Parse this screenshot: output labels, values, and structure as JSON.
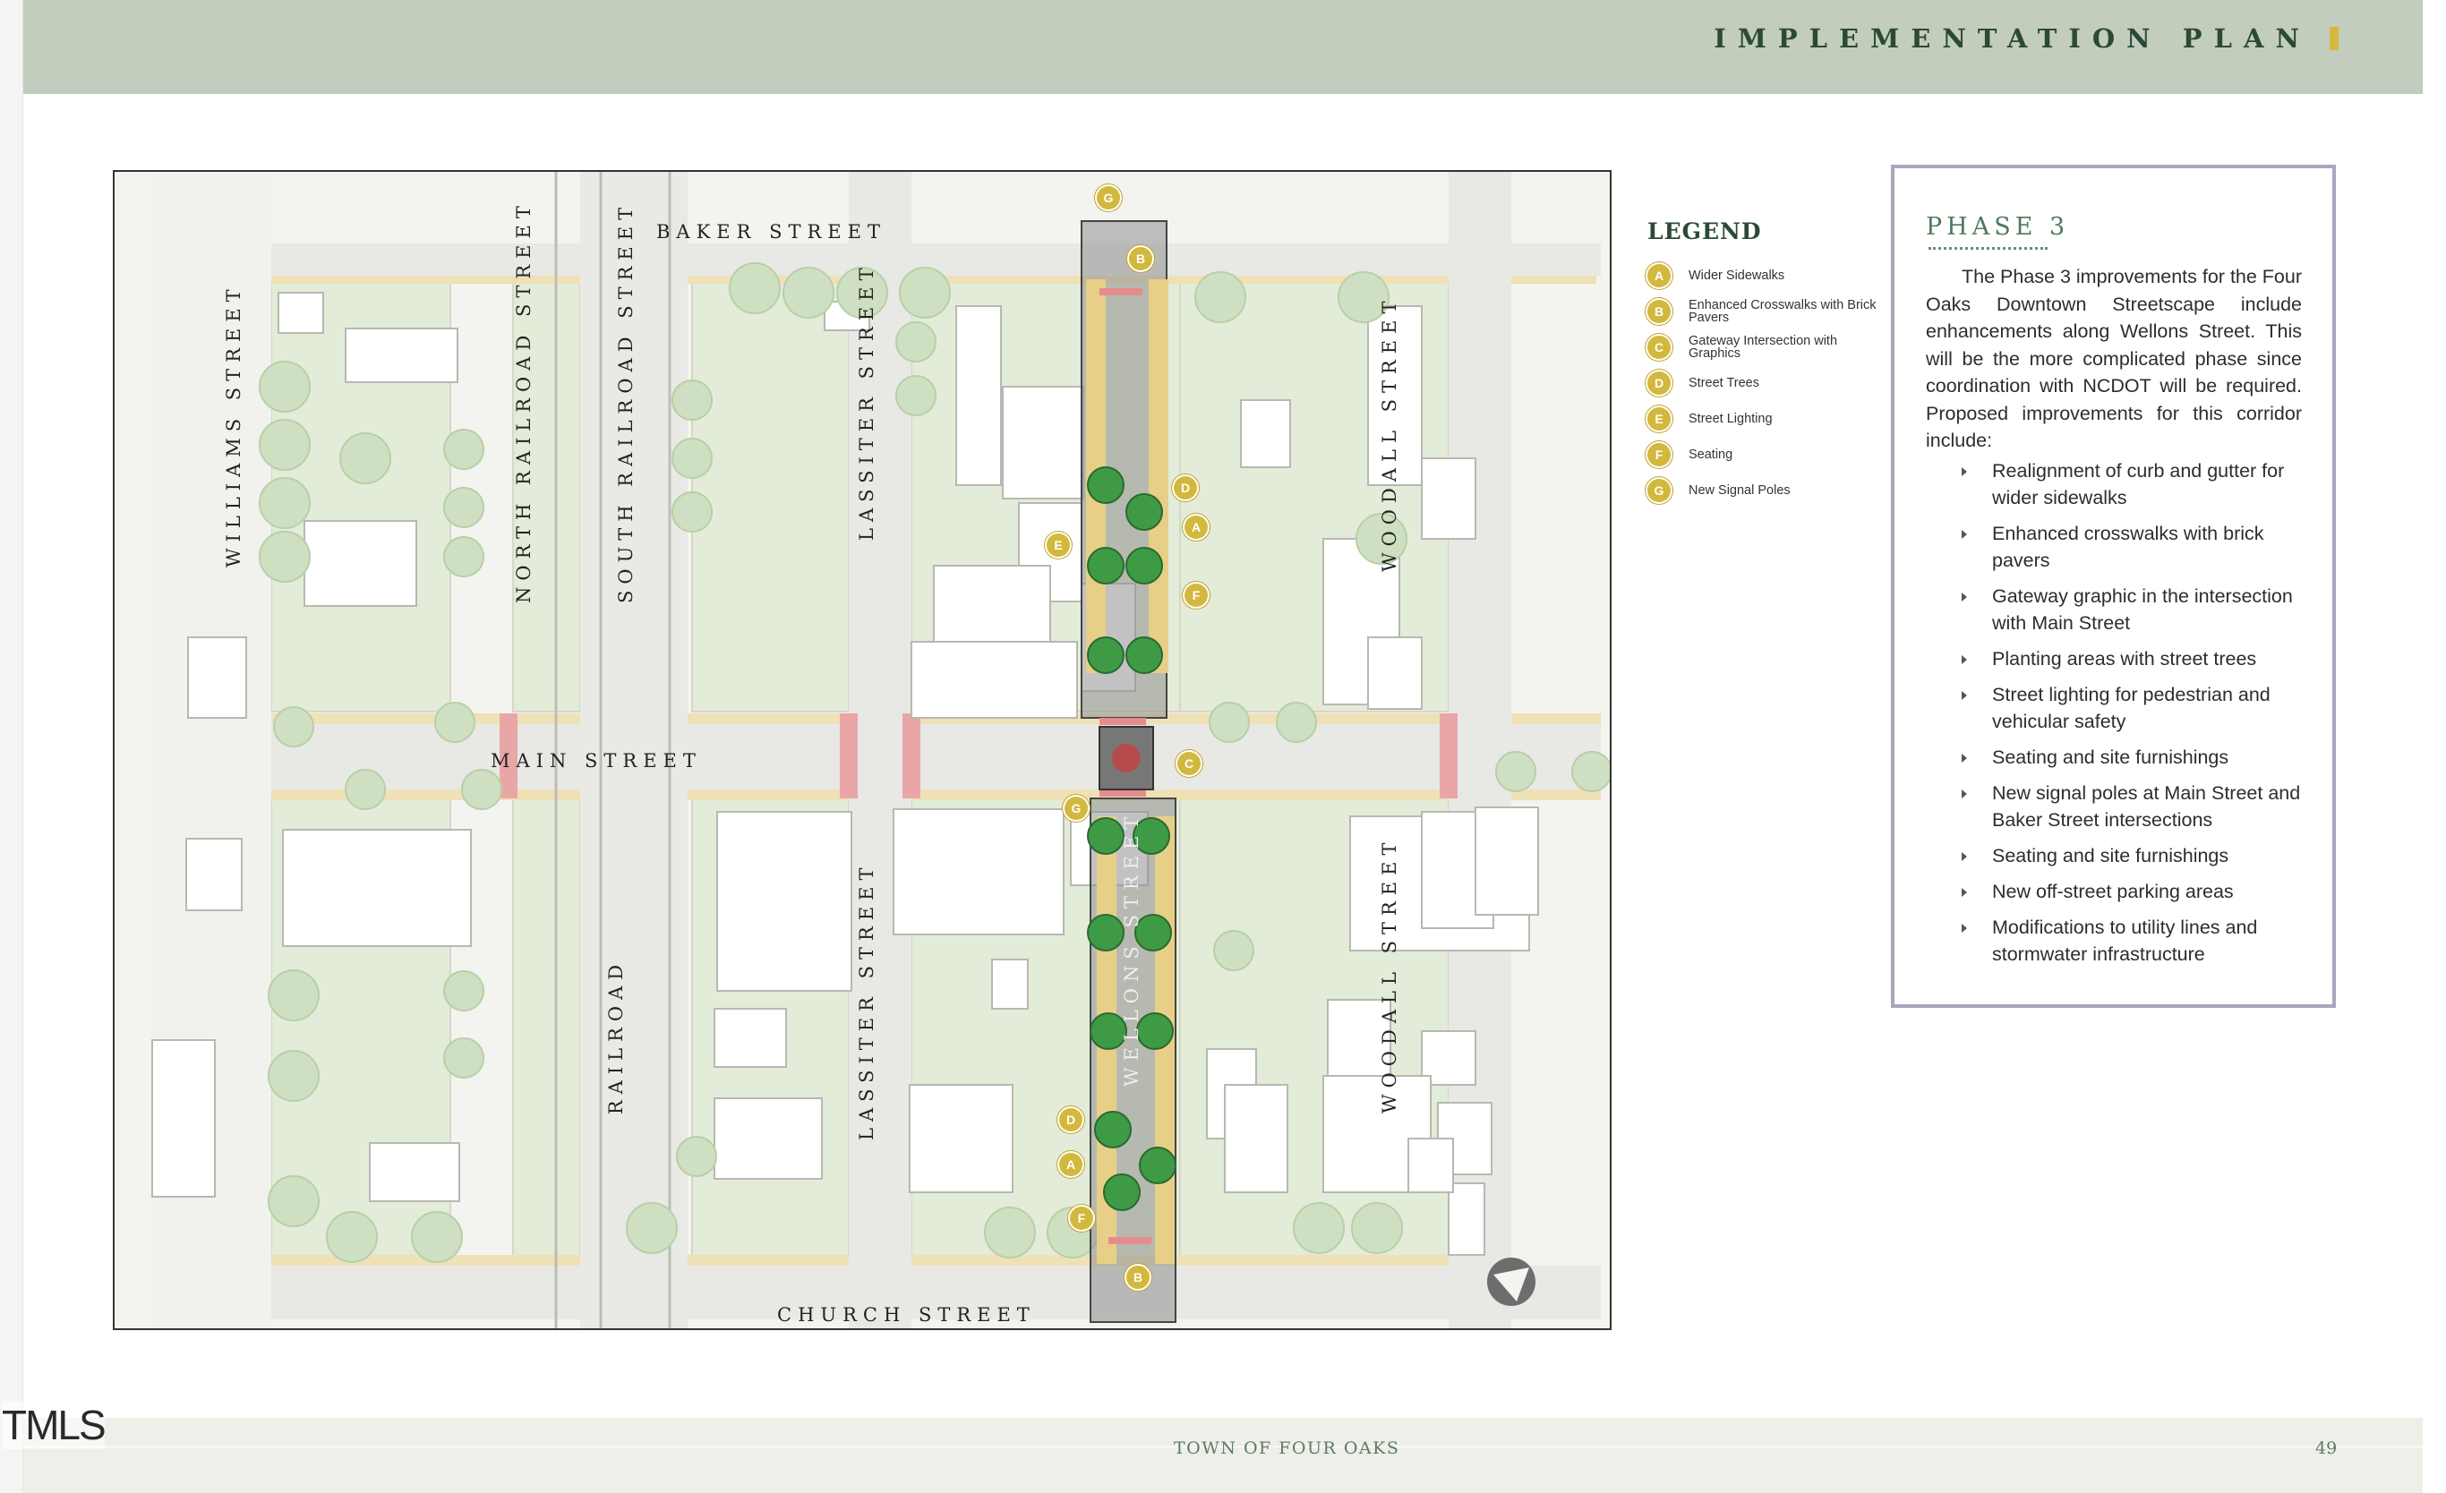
{
  "header": {
    "title": "IMPLEMENTATION PLAN"
  },
  "plan": {
    "streets": {
      "baker": "BAKER STREET",
      "main": "MAIN STREET",
      "church": "CHURCH STREET",
      "williams": "WILLIAMS STREET",
      "north_railroad": "NORTH RAILROAD STREET",
      "south_railroad": "SOUTH RAILROAD STREET",
      "railroad": "RAILROAD",
      "lassiter_top": "LASSITER STREET",
      "lassiter_bottom": "LASSITER STREET",
      "woodall_top": "WOODALL STREET",
      "woodall_bottom": "WOODALL STREET",
      "wellons": "WELLONS STREET"
    },
    "markers": [
      "G",
      "B",
      "D",
      "A",
      "E",
      "F",
      "C",
      "G",
      "D",
      "A",
      "F",
      "B"
    ]
  },
  "legend": {
    "title": "LEGEND",
    "items": [
      {
        "badge": "A",
        "label": "Wider Sidewalks"
      },
      {
        "badge": "B",
        "label": "Enhanced Crosswalks with Brick Pavers"
      },
      {
        "badge": "C",
        "label": "Gateway Intersection with Graphics"
      },
      {
        "badge": "D",
        "label": "Street Trees"
      },
      {
        "badge": "E",
        "label": "Street Lighting"
      },
      {
        "badge": "F",
        "label": "Seating"
      },
      {
        "badge": "G",
        "label": "New Signal Poles"
      }
    ]
  },
  "phase": {
    "title": "PHASE 3",
    "intro": "The Phase 3 improvements for the Four Oaks Downtown Streetscape include enhancements along Wellons Street. This will be the more complicated phase since coordination with NCDOT will be required. Proposed improvements for this corridor include:",
    "bullets": [
      "Realignment of curb and gutter for wider sidewalks",
      "Enhanced crosswalks with brick pavers",
      "Gateway graphic in the intersection with Main Street",
      "Planting areas with street trees",
      "Street lighting for pedestrian and vehicular safety",
      "Seating and site furnishings",
      "New signal poles at Main Street and Baker Street intersections",
      "Seating and site furnishings",
      "New off-street parking areas",
      "Modifications to utility lines and stormwater infrastructure"
    ]
  },
  "footer": {
    "title": "TOWN OF FOUR OAKS",
    "page": "49"
  },
  "watermark": "TMLS",
  "colors": {
    "header_band": "#c3cdbd",
    "accent_gold": "#d3b83e",
    "dark_green": "#2b4a35",
    "phase_border": "#a7a6be"
  }
}
